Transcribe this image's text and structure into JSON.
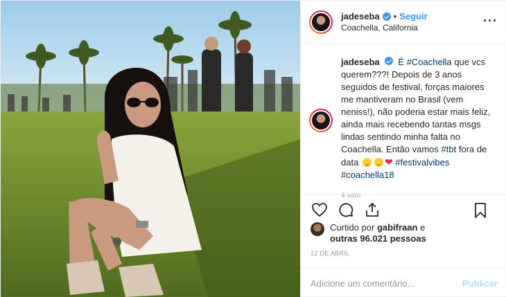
{
  "post": {
    "username": "jadeseba",
    "follow_label": "Seguir",
    "location": "Coachella, California",
    "more_icon": "more-options-icon",
    "caption": {
      "username": "jadeseba",
      "text_1": "É",
      "tag_coachella": "#Coachella",
      "text_2": "que vcs querem???! Depois de 3 anos seguidos de festival, forças maiores me mantiveram no Brasil (vem neniss!), não poderia estar mais feliz, ainda mais recebendo tantas msgs lindas sentindo minha falta no Coachella. Então vamos",
      "tag_tbt": "#tbt",
      "text_3": "fora de data",
      "tag_festivalvibes": "#festivalvibes",
      "tag_coachella18": "#coachella18",
      "age": "4 sem"
    },
    "actions": {
      "like_icon": "heart-icon",
      "comment_icon": "comment-icon",
      "share_icon": "share-icon",
      "save_icon": "bookmark-icon"
    },
    "likes": {
      "prefix": "Curtido por",
      "user": "gabifraan",
      "conj": "e",
      "others": "outras 96.021 pessoas"
    },
    "date": "12 DE ABRIL",
    "comment_placeholder": "Adicione um comentário...",
    "publish_label": "Publicar"
  },
  "colors": {
    "link_blue": "#3897f0",
    "hashtag": "#003569",
    "publish_disabled": "#b2dffc",
    "muted": "#999999"
  }
}
